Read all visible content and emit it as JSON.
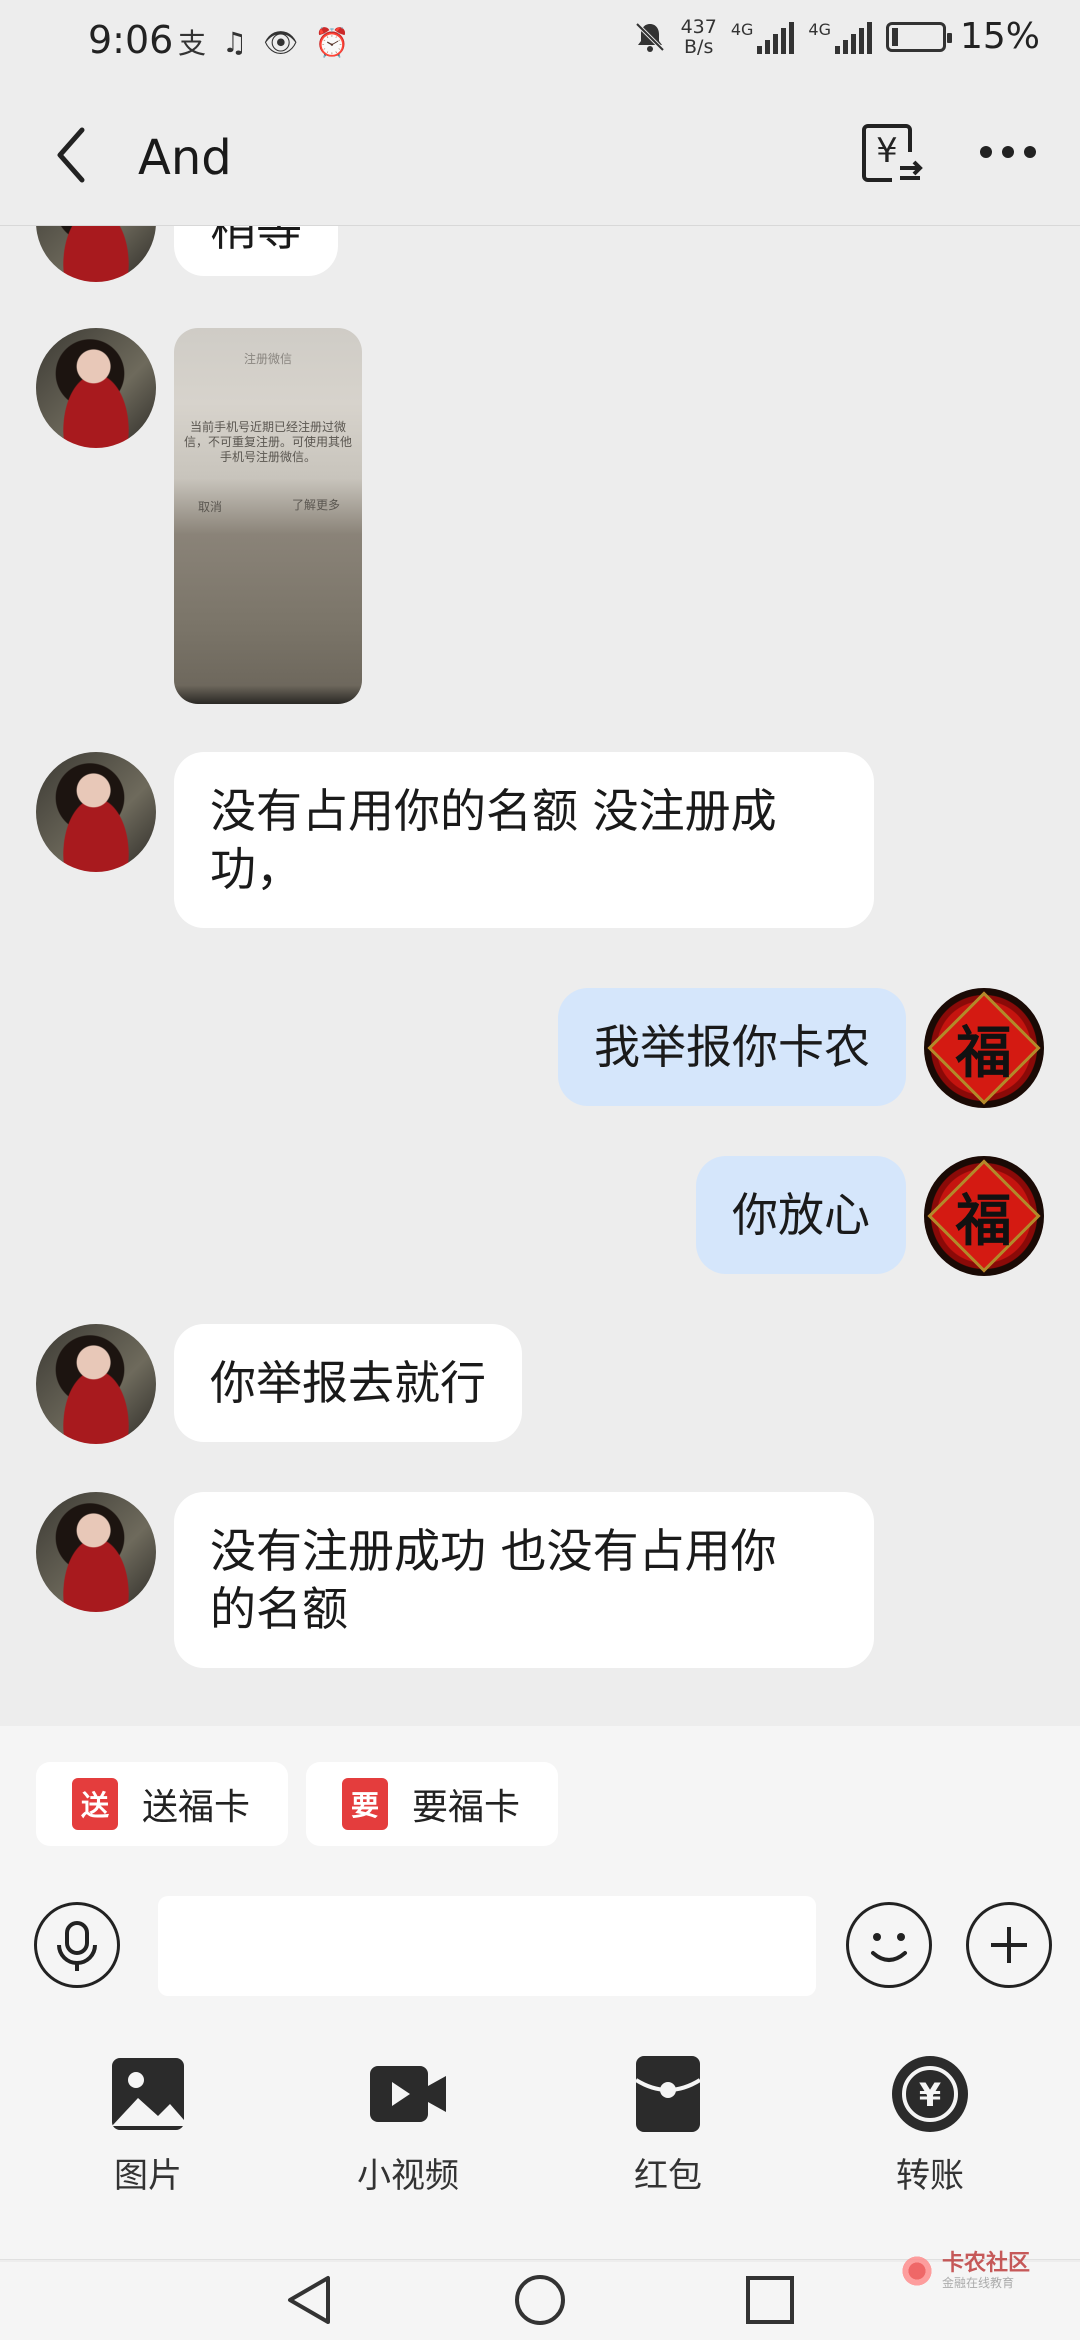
{
  "status_bar": {
    "time": "9:06",
    "app_icons": [
      "支",
      "♫",
      "👁",
      "⏰"
    ],
    "speed_value": "437",
    "speed_unit": "B/s",
    "network_1": "4G",
    "network_2": "4G",
    "battery": "15%"
  },
  "nav": {
    "title": "And"
  },
  "messages": [
    {
      "side": "other",
      "type": "text",
      "text": "稍等"
    },
    {
      "side": "other",
      "type": "image",
      "image_text": {
        "top": "注册微信",
        "body": "当前手机号近期已经注册过微信，不可重复注册。可使用其他手机号注册微信。",
        "cancel": "取消",
        "learn_more": "了解更多"
      }
    },
    {
      "side": "other",
      "type": "text",
      "line1": "没有占用你的名额 没注册成",
      "line2": "功，"
    },
    {
      "side": "me",
      "type": "text",
      "text": "我举报你卡农"
    },
    {
      "side": "me",
      "type": "text",
      "text": "你放心"
    },
    {
      "side": "other",
      "type": "text",
      "text": "你举报去就行"
    },
    {
      "side": "other",
      "type": "text",
      "line1": "没有注册成功 也没有占用你",
      "line2": "的名额"
    }
  ],
  "my_avatar_char": "福",
  "quick_actions": [
    {
      "icon_char": "送",
      "label": "送福卡"
    },
    {
      "icon_char": "要",
      "label": "要福卡"
    }
  ],
  "input": {
    "placeholder": ""
  },
  "tools": [
    {
      "icon": "image-icon",
      "label": "图片"
    },
    {
      "icon": "video-icon",
      "label": "小视频"
    },
    {
      "icon": "red-packet-icon",
      "label": "红包"
    },
    {
      "icon": "transfer-icon",
      "label": "转账"
    }
  ],
  "watermark": {
    "main": "卡农社区",
    "sub": "金融在线教育"
  }
}
